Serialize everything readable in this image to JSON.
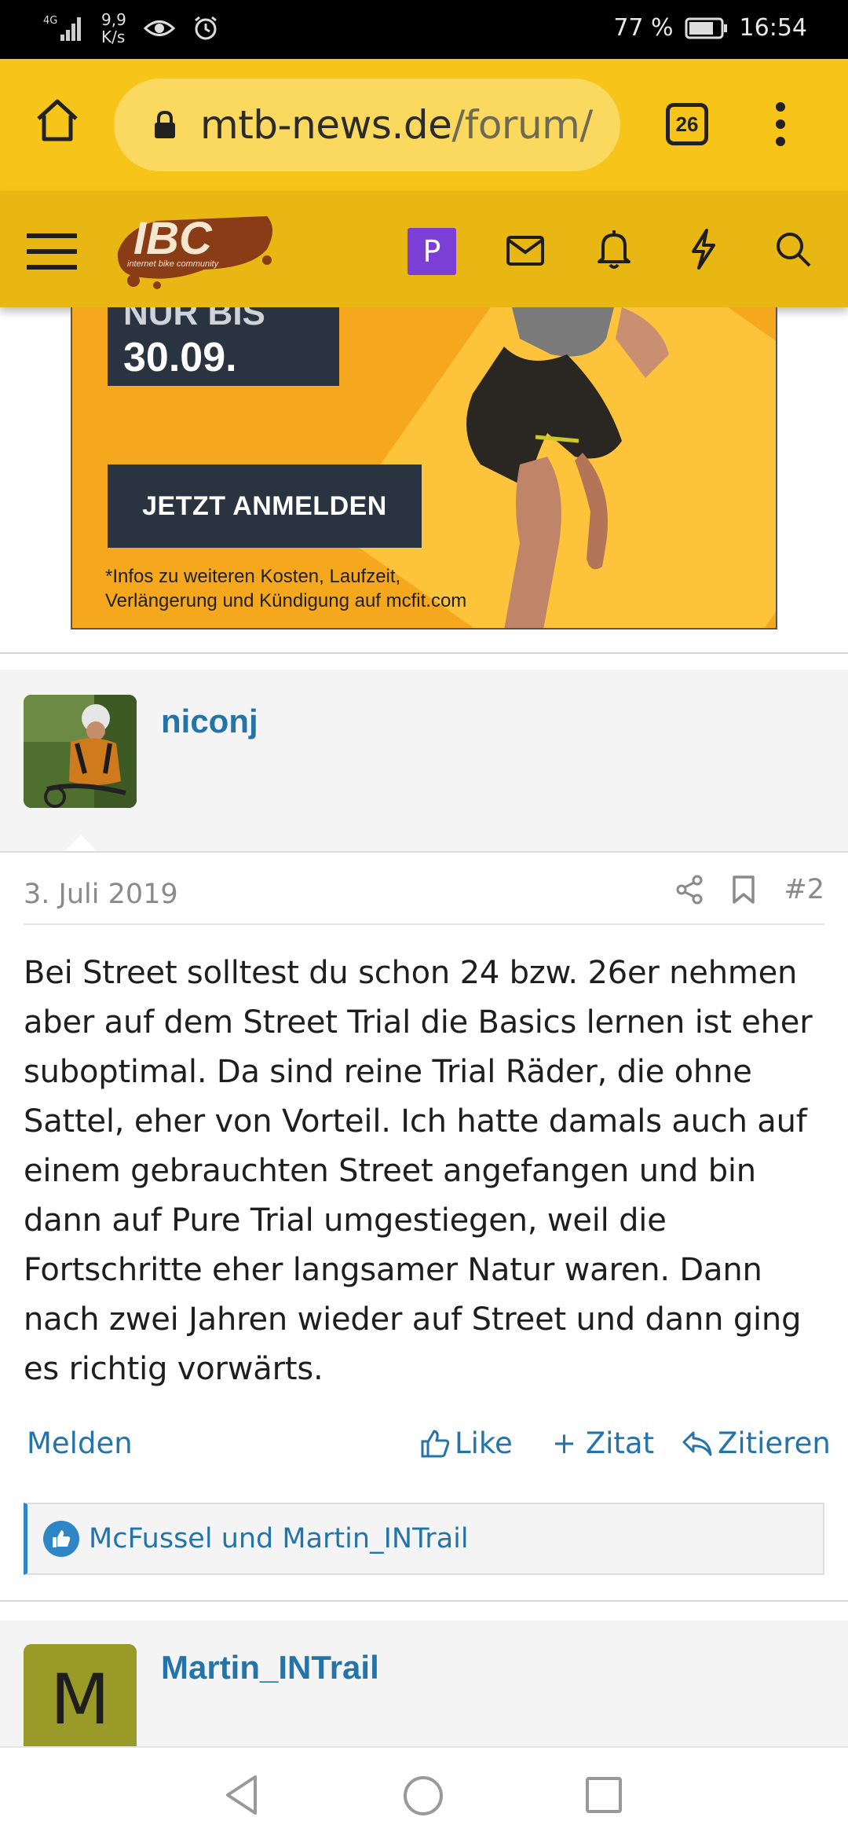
{
  "status_bar": {
    "network": "4G",
    "net_speed_value": "9,9",
    "net_speed_unit": "K/s",
    "battery_percent": "77 %",
    "time": "16:54"
  },
  "browser": {
    "url_domain": "mtb-news.de",
    "url_path": "/forum/",
    "tab_count": "26"
  },
  "site_header": {
    "logo_text": "IBC",
    "logo_tagline": "internet bike community",
    "user_initial": "P"
  },
  "ad": {
    "offer_label": "NUR BIS",
    "offer_date": "30.09.",
    "cta_label": "JETZT ANMELDEN",
    "disclaimer_line1": "*Infos zu weiteren Kosten, Laufzeit,",
    "disclaimer_line2": "Verlängerung und Kündigung auf mcfit.com"
  },
  "post": {
    "author": "niconj",
    "date": "3. Juli 2019",
    "number": "#2",
    "body_lines": [
      "Bei Street solltest du schon 24 bzw. 26er nehmen",
      "aber auf dem Street Trial die Basics lernen ist eher",
      "suboptimal. Da sind reine Trial Räder, die ohne",
      "Sattel, eher von Vorteil. Ich hatte damals auch auf",
      "einem gebrauchten Street angefangen und bin",
      "dann auf Pure Trial umgestiegen, weil die",
      "Fortschritte eher langsamer Natur waren. Dann",
      "nach zwei Jahren wieder auf Street und dann ging",
      "es richtig vorwärts."
    ],
    "report_label": "Melden",
    "like_label": "Like",
    "quote_label": "+ Zitat",
    "reply_label": "Zitieren",
    "likes_text": "McFussel und Martin_INTrail"
  },
  "next_post": {
    "author": "Martin_INTrail",
    "avatar_letter": "M"
  },
  "colors": {
    "browser_bar": "#f7c51a",
    "site_header": "#e8b714",
    "link_blue": "#2574a9",
    "avatar_purple": "#7b3fd6"
  }
}
